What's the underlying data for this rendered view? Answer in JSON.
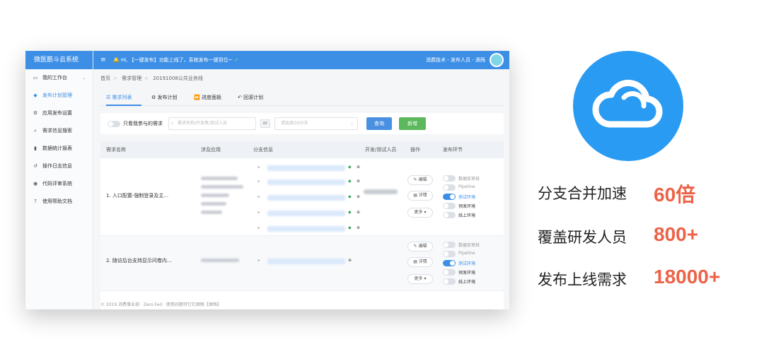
{
  "sidebar": {
    "brand": "微医筋斗云系统",
    "items": [
      {
        "icon": "monitor-icon",
        "glyph": "▭",
        "label": "我的工作台"
      },
      {
        "icon": "diamond-icon",
        "glyph": "◆",
        "label": "发布计划管理"
      },
      {
        "icon": "gears-icon",
        "glyph": "⚙",
        "label": "应用发布设置"
      },
      {
        "icon": "search-icon",
        "glyph": "⌕",
        "label": "需求信息搜索"
      },
      {
        "icon": "bar-chart-icon",
        "glyph": "▮",
        "label": "数据统计报表"
      },
      {
        "icon": "history-icon",
        "glyph": "↺",
        "label": "操作日志信息"
      },
      {
        "icon": "eye-icon",
        "glyph": "◉",
        "label": "代码评审系统"
      },
      {
        "icon": "help-icon",
        "glyph": "?",
        "label": "使用帮助文档"
      }
    ]
  },
  "topbar": {
    "notice": "Hi, 【一键发布】功能上线了，系统发布一键到位~",
    "user": "消费技术 - 发布人员 - 酒殇"
  },
  "breadcrumb": [
    "首页",
    "需求管理",
    "20191008公共业务线"
  ],
  "tabs": [
    "需求列表",
    "发布计划",
    "进度面板",
    "回滚计划"
  ],
  "filters": {
    "toggle_label": "只看我参与的需求",
    "search_placeholder": "需求名称/开发者/测试人员",
    "or_label": "or",
    "select_placeholder": "请选择Git分支",
    "query_label": "查询",
    "new_label": "新增"
  },
  "table": {
    "headers": [
      "需求名称",
      "涉及应用",
      "分支信息",
      "开发/测试人员",
      "操作",
      "发布环节"
    ],
    "rows": [
      {
        "name": "1. 入口配置-强制登录及主...",
        "branches": 5
      },
      {
        "name": "2. 随访后台支持显示问卷内...",
        "branches": 1
      }
    ],
    "actions": {
      "edit": "编辑",
      "detail": "详情",
      "more": "更多"
    },
    "env_stages": [
      "数据库审核",
      "Pipeline",
      "测试环境",
      "预发环境",
      "线上环境"
    ]
  },
  "footer": "© 2019 消费事业部 · Zero.Fed · 使用问题可钉钉酒殇【酒殇】",
  "stats": [
    {
      "label": "分支合并加速",
      "value": "60倍"
    },
    {
      "label": "覆盖研发人员",
      "value": "800+"
    },
    {
      "label": "发布上线需求",
      "value": "18000+"
    }
  ]
}
